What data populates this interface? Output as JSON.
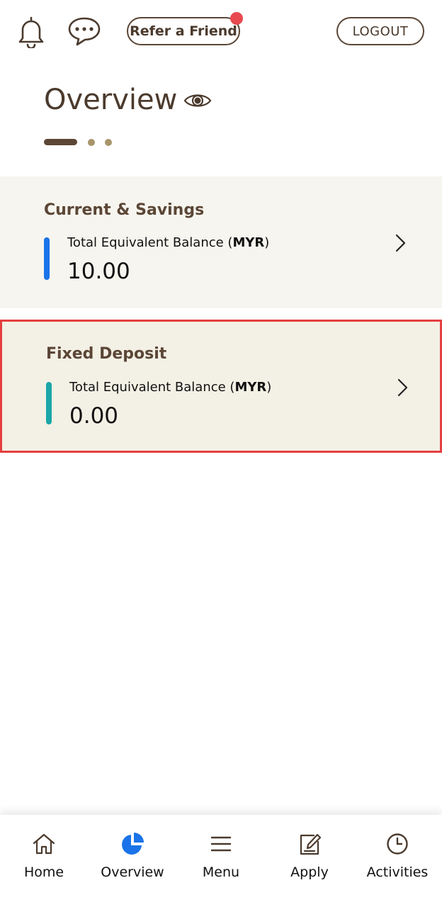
{
  "header": {
    "refer_label": "Refer a Friend",
    "logout_label": "LOGOUT",
    "icons": {
      "bell": "bell-icon",
      "chat": "chat-bubble-icon",
      "notification_dot": "#e8494f"
    }
  },
  "overview": {
    "title": "Overview",
    "visibility_icon": "eye-icon",
    "pager": {
      "pages": 3,
      "active": 0
    }
  },
  "accounts": [
    {
      "title": "Current & Savings",
      "label_prefix": "Total Equivalent Balance (",
      "currency": "MYR",
      "label_suffix": ")",
      "balance": "10.00",
      "accent_color": "#1a73e8"
    },
    {
      "title": "Fixed Deposit",
      "label_prefix": "Total Equivalent Balance (",
      "currency": "MYR",
      "label_suffix": ")",
      "balance": "0.00",
      "accent_color": "#1aa6a8",
      "highlighted": true
    }
  ],
  "bottom_nav": [
    {
      "label": "Home",
      "icon": "home-icon",
      "active": false
    },
    {
      "label": "Overview",
      "icon": "pie-chart-icon",
      "active": true,
      "active_color": "#1a73e8"
    },
    {
      "label": "Menu",
      "icon": "hamburger-menu-icon",
      "active": false
    },
    {
      "label": "Apply",
      "icon": "edit-document-icon",
      "active": false
    },
    {
      "label": "Activities",
      "icon": "clock-icon",
      "active": false
    }
  ]
}
